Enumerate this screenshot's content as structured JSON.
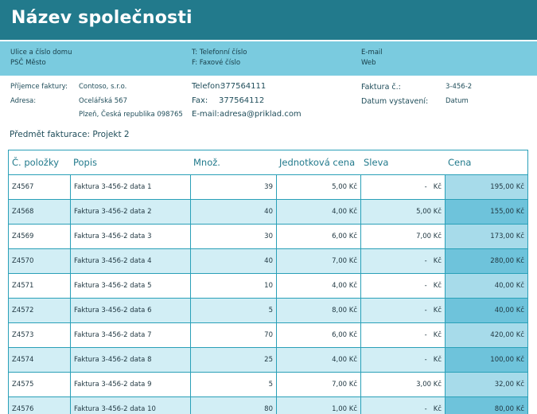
{
  "company": {
    "name": "Název společnosti"
  },
  "contact": {
    "street": "Ulice a číslo domu",
    "city": "PSČ Město",
    "phone": "T: Telefonní číslo",
    "fax": "F: Faxové číslo",
    "email": "E-mail",
    "web": "Web"
  },
  "recipient": {
    "label": "Příjemce faktury:",
    "name": "Contoso, s.r.o.",
    "address_label": "Adresa:",
    "address_line1": "Ocelářská 567",
    "address_line2": "Plzeň, Česká republika 098765"
  },
  "recipient_contact": {
    "phone_label": "Telefon:",
    "phone": "377564111",
    "fax_label": "Fax:",
    "fax": "377564112",
    "email_label": "E-mail:",
    "email": "adresa@priklad.com"
  },
  "invoice": {
    "number_label": "Faktura č.:",
    "number": "3-456-2",
    "date_label": "Datum vystavení:",
    "date": "Datum"
  },
  "subject": "Předmět fakturace: Projekt 2",
  "table": {
    "headers": [
      "Č. položky",
      "Popis",
      "Množ.",
      "Jednotková cena",
      "Sleva",
      "Cena"
    ],
    "rows": [
      {
        "id": "Z4567",
        "desc": "Faktura 3-456-2 data 1",
        "qty": "39",
        "unit": "5,00 Kč",
        "disc": "-",
        "disc_cur": "Kč",
        "price": "195,00 Kč"
      },
      {
        "id": "Z4568",
        "desc": "Faktura 3-456-2 data 2",
        "qty": "40",
        "unit": "4,00 Kč",
        "disc": "5,00 Kč",
        "disc_cur": "",
        "price": "155,00 Kč"
      },
      {
        "id": "Z4569",
        "desc": "Faktura 3-456-2 data 3",
        "qty": "30",
        "unit": "6,00 Kč",
        "disc": "7,00 Kč",
        "disc_cur": "",
        "price": "173,00 Kč"
      },
      {
        "id": "Z4570",
        "desc": "Faktura 3-456-2 data 4",
        "qty": "40",
        "unit": "7,00 Kč",
        "disc": "-",
        "disc_cur": "Kč",
        "price": "280,00 Kč"
      },
      {
        "id": "Z4571",
        "desc": "Faktura 3-456-2 data 5",
        "qty": "10",
        "unit": "4,00 Kč",
        "disc": "-",
        "disc_cur": "Kč",
        "price": "40,00 Kč"
      },
      {
        "id": "Z4572",
        "desc": "Faktura 3-456-2 data 6",
        "qty": "5",
        "unit": "8,00 Kč",
        "disc": "-",
        "disc_cur": "Kč",
        "price": "40,00 Kč"
      },
      {
        "id": "Z4573",
        "desc": "Faktura 3-456-2 data 7",
        "qty": "70",
        "unit": "6,00 Kč",
        "disc": "-",
        "disc_cur": "Kč",
        "price": "420,00 Kč"
      },
      {
        "id": "Z4574",
        "desc": "Faktura 3-456-2 data 8",
        "qty": "25",
        "unit": "4,00 Kč",
        "disc": "-",
        "disc_cur": "Kč",
        "price": "100,00 Kč"
      },
      {
        "id": "Z4575",
        "desc": "Faktura 3-456-2 data 9",
        "qty": "5",
        "unit": "7,00 Kč",
        "disc": "3,00 Kč",
        "disc_cur": "",
        "price": "32,00 Kč"
      },
      {
        "id": "Z4576",
        "desc": "Faktura 3-456-2 data 10",
        "qty": "80",
        "unit": "1,00 Kč",
        "disc": "-",
        "disc_cur": "Kč",
        "price": "80,00 Kč"
      }
    ]
  },
  "colors": {
    "title_band": "#227a8c",
    "contact_band": "#7acbdf",
    "row_alt": "#d2eef5",
    "price_light": "#a7dbea",
    "price_dark": "#6ec3db",
    "border": "#2aa0b8"
  }
}
